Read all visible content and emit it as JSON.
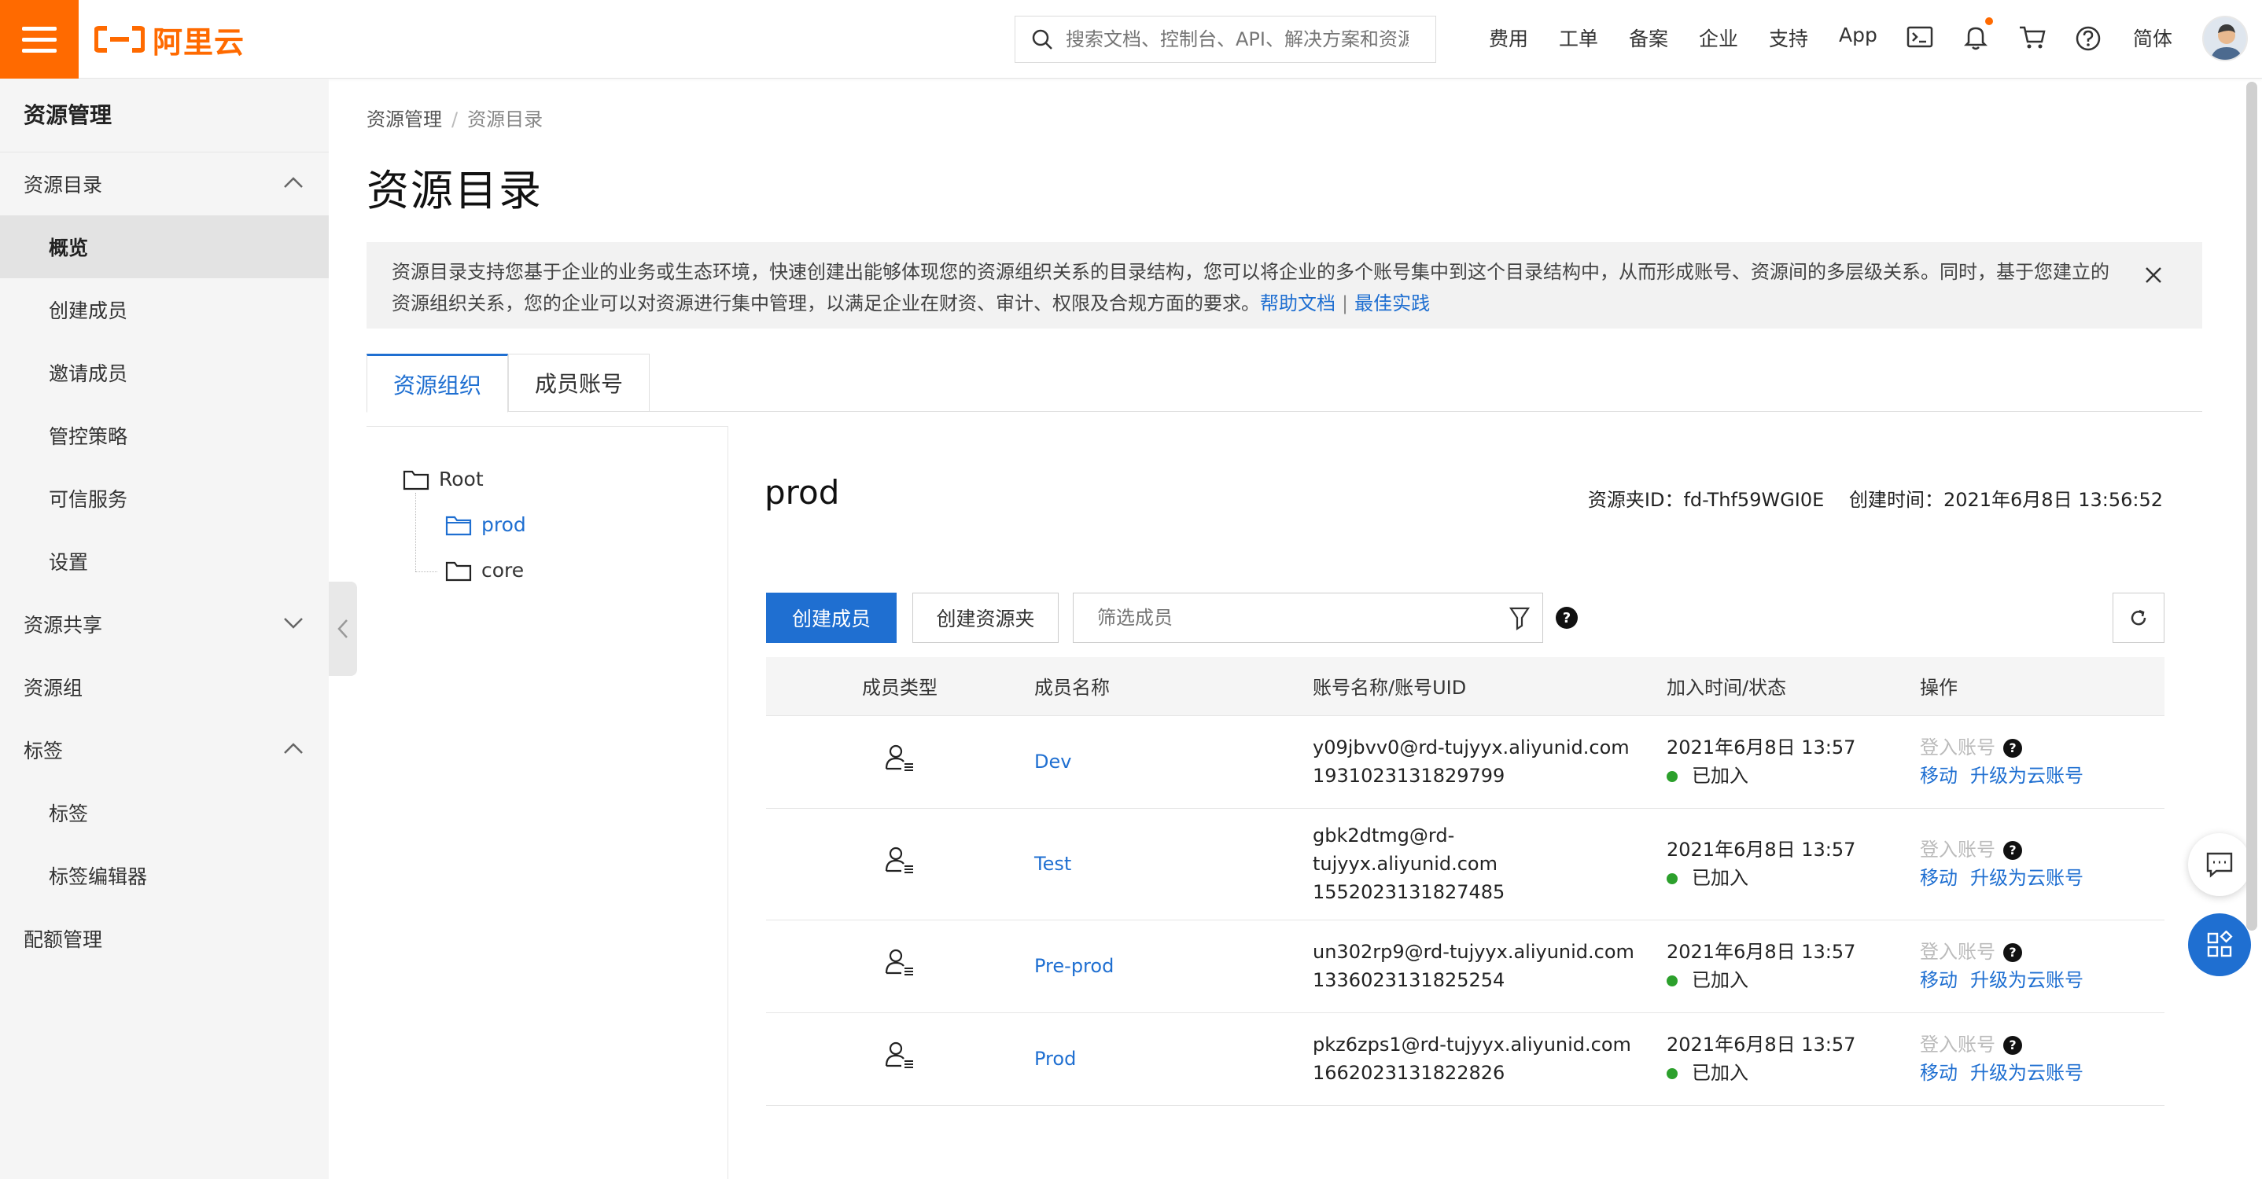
{
  "header": {
    "logo_text": "阿里云",
    "search_placeholder": "搜索文档、控制台、API、解决方案和资源",
    "nav": [
      "费用",
      "工单",
      "备案",
      "企业",
      "支持",
      "App"
    ],
    "lang": "简体",
    "brand_color": "#ff6a00"
  },
  "sidebar": {
    "title": "资源管理",
    "items": [
      {
        "label": "资源目录",
        "level": 1,
        "expanded": true
      },
      {
        "label": "概览",
        "level": 2,
        "active": true
      },
      {
        "label": "创建成员",
        "level": 2
      },
      {
        "label": "邀请成员",
        "level": 2
      },
      {
        "label": "管控策略",
        "level": 2
      },
      {
        "label": "可信服务",
        "level": 2
      },
      {
        "label": "设置",
        "level": 2
      },
      {
        "label": "资源共享",
        "level": 1,
        "expanded": false
      },
      {
        "label": "资源组",
        "level": 1
      },
      {
        "label": "标签",
        "level": 1,
        "expanded": true
      },
      {
        "label": "标签",
        "level": 2
      },
      {
        "label": "标签编辑器",
        "level": 2
      },
      {
        "label": "配额管理",
        "level": 1
      }
    ]
  },
  "breadcrumb": {
    "root": "资源管理",
    "sep": "/",
    "current": "资源目录"
  },
  "page_title": "资源目录",
  "notice": {
    "text": "资源目录支持您基于企业的业务或生态环境，快速创建出能够体现您的资源组织关系的目录结构，您可以将企业的多个账号集中到这个目录结构中，从而形成账号、资源间的多层级关系。同时，基于您建立的资源组织关系，您的企业可以对资源进行集中管理，以满足企业在财资、审计、权限及合规方面的要求。",
    "link_help": "帮助文档",
    "divider": "|",
    "link_best": "最佳实践"
  },
  "tabs": [
    {
      "label": "资源组织",
      "active": true
    },
    {
      "label": "成员账号",
      "active": false
    }
  ],
  "tree": {
    "root": "Root",
    "children": [
      {
        "label": "prod",
        "selected": true
      },
      {
        "label": "core",
        "selected": false
      }
    ]
  },
  "folder": {
    "name": "prod",
    "id_label": "资源夹ID：",
    "id": "fd-Thf59WGI0E",
    "created_label": "创建时间：",
    "created": "2021年6月8日 13:56:52"
  },
  "toolbar": {
    "create_member": "创建成员",
    "create_folder": "创建资源夹",
    "filter_placeholder": "筛选成员",
    "help": "?"
  },
  "table": {
    "headers": [
      "成员类型",
      "成员名称",
      "账号名称/账号UID",
      "加入时间/状态",
      "操作"
    ],
    "rows": [
      {
        "name": "Dev",
        "account_lines": [
          "y09jbvv0@rd-tujyyx.aliyunid.com",
          "1931023131829799"
        ],
        "join_time": "2021年6月8日 13:57",
        "status": "已加入",
        "op_login": "登入账号",
        "op_move": "移动",
        "op_upgrade": "升级为云账号"
      },
      {
        "name": "Test",
        "account_lines": [
          "gbk2dtmg@rd-",
          "tujyyx.aliyunid.com",
          "1552023131827485"
        ],
        "join_time": "2021年6月8日 13:57",
        "status": "已加入",
        "op_login": "登入账号",
        "op_move": "移动",
        "op_upgrade": "升级为云账号"
      },
      {
        "name": "Pre-prod",
        "account_lines": [
          "un302rp9@rd-tujyyx.aliyunid.com",
          "1336023131825254"
        ],
        "join_time": "2021年6月8日 13:57",
        "status": "已加入",
        "op_login": "登入账号",
        "op_move": "移动",
        "op_upgrade": "升级为云账号"
      },
      {
        "name": "Prod",
        "account_lines": [
          "pkz6zps1@rd-tujyyx.aliyunid.com",
          "1662023131822826"
        ],
        "join_time": "2021年6月8日 13:57",
        "status": "已加入",
        "op_login": "登入账号",
        "op_move": "移动",
        "op_upgrade": "升级为云账号"
      }
    ]
  },
  "colors": {
    "accent": "#1f6fd1",
    "status_ok": "#2ca02c",
    "float_blue": "#1f6fd1"
  }
}
